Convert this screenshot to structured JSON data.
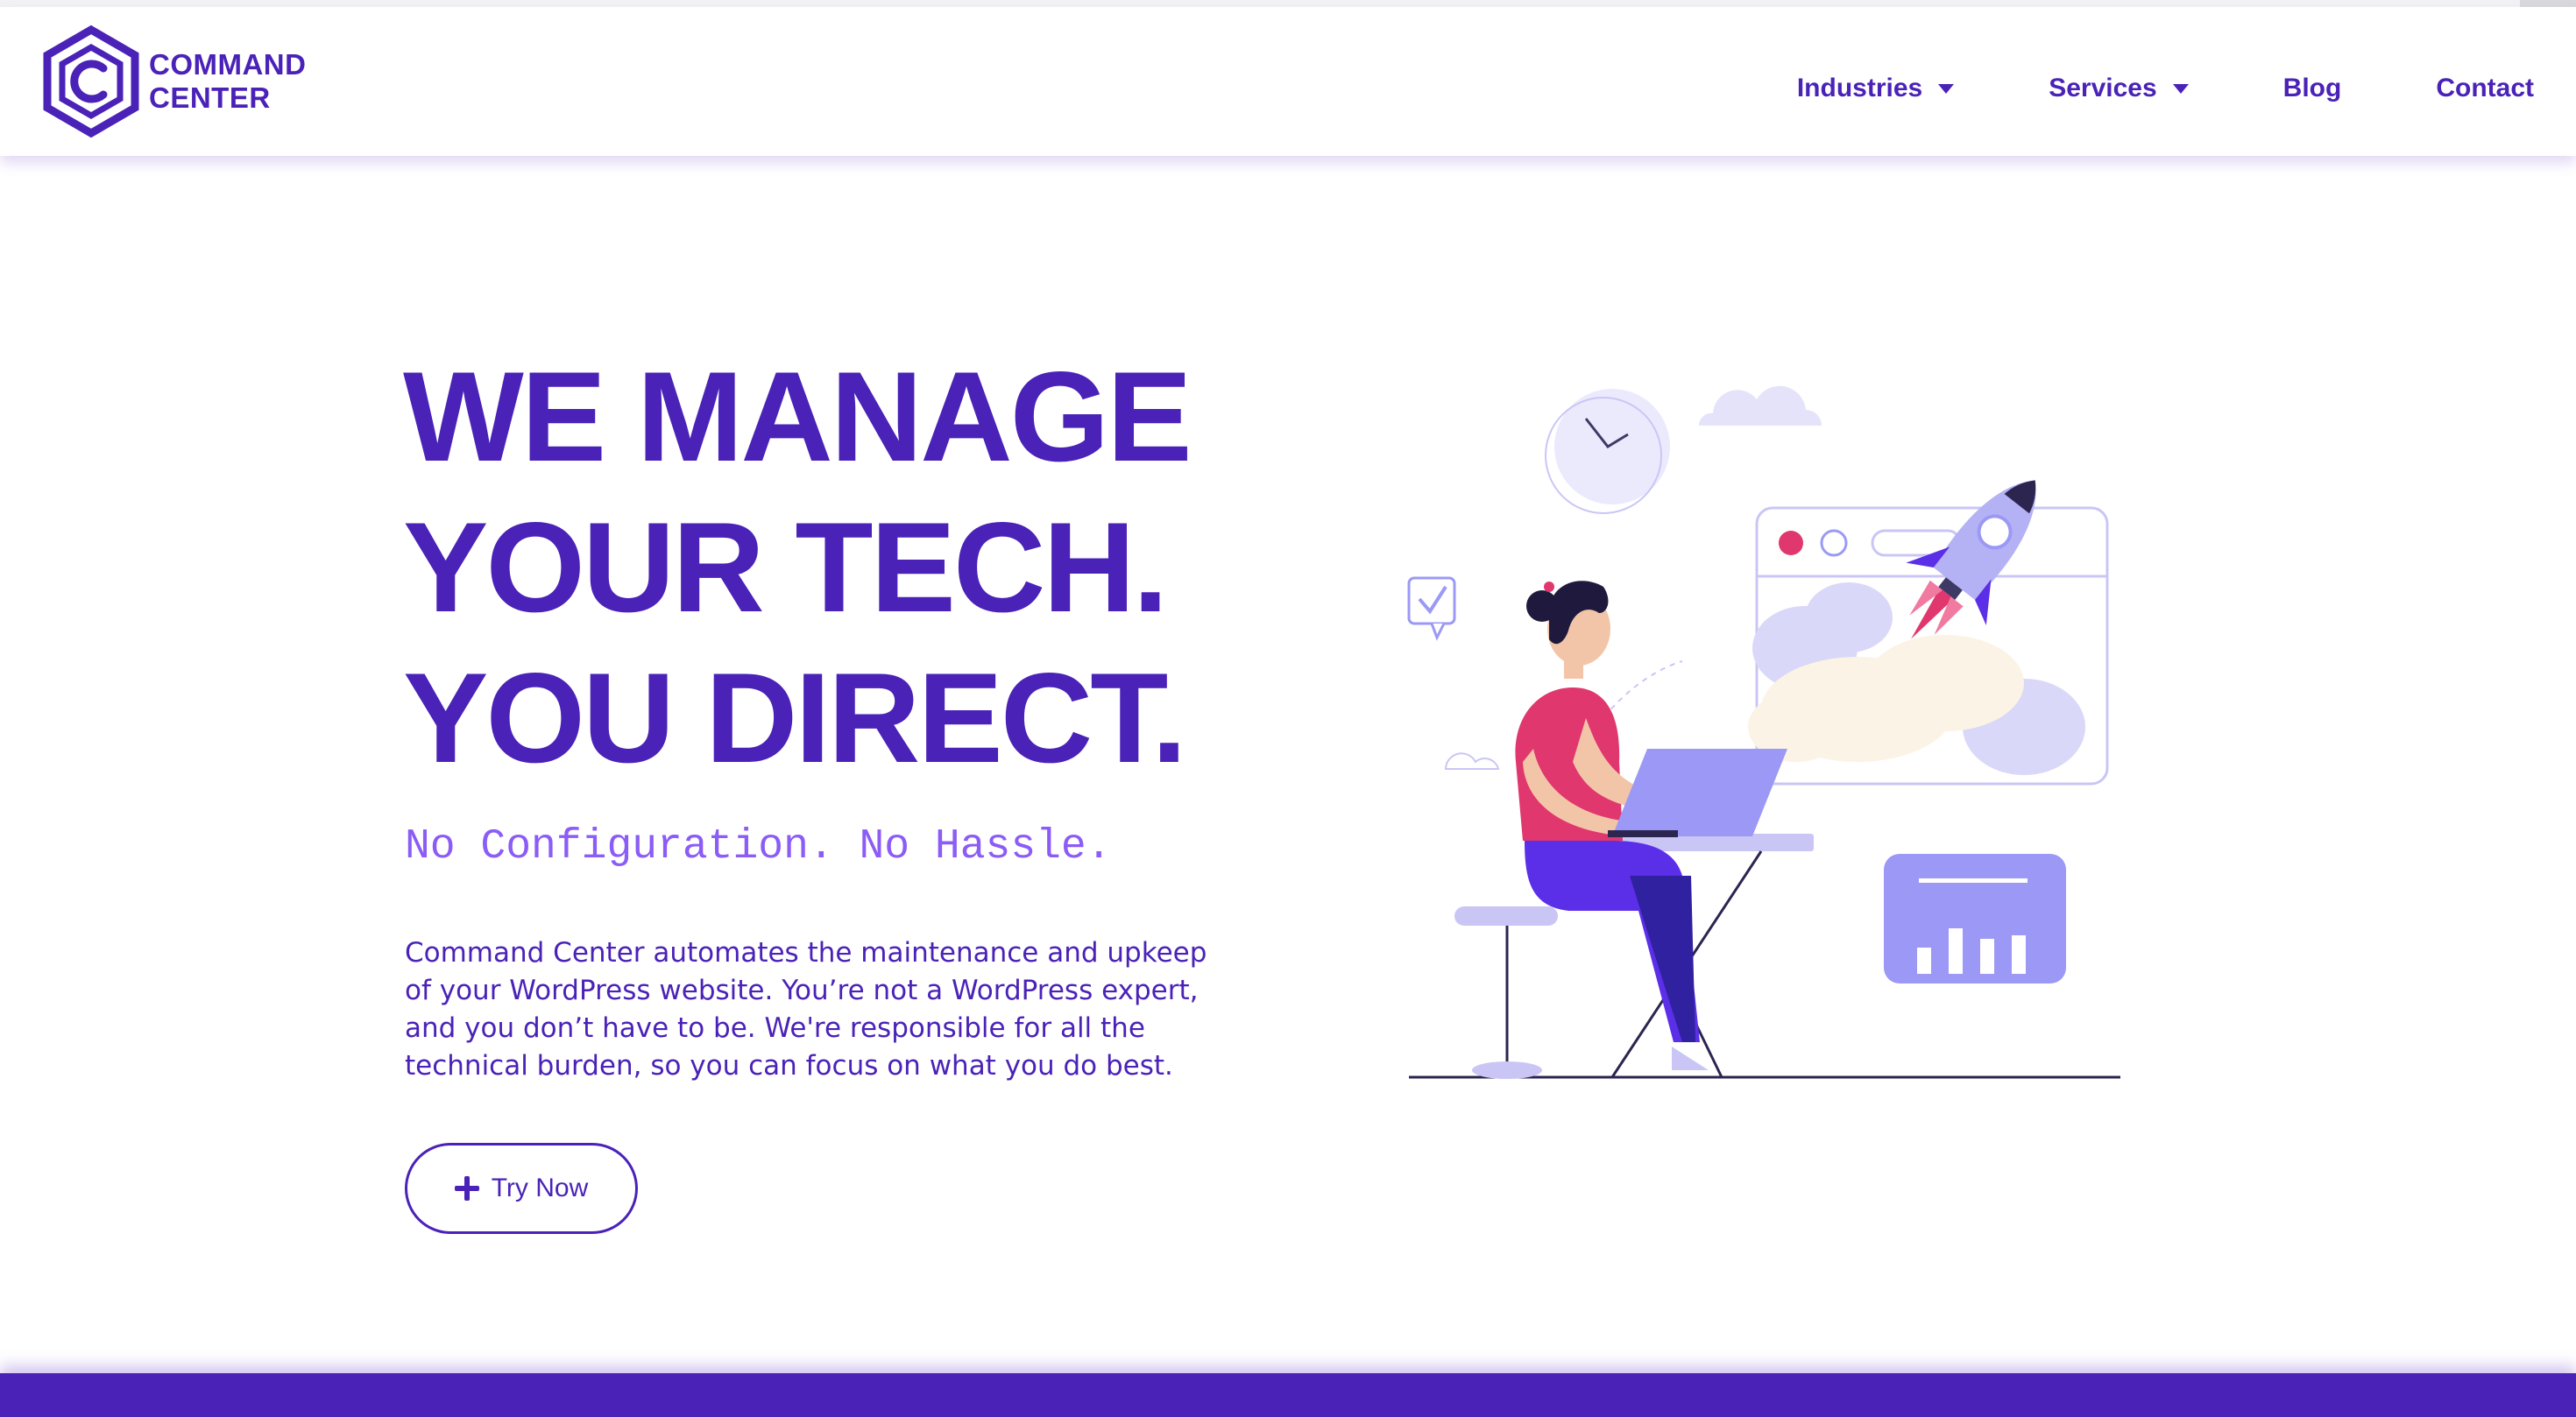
{
  "header": {
    "logo": {
      "line1": "COMMAND",
      "line2": "CENTER"
    },
    "nav": [
      {
        "label": "Industries",
        "has_dropdown": true
      },
      {
        "label": "Services",
        "has_dropdown": true
      },
      {
        "label": "Blog",
        "has_dropdown": false
      },
      {
        "label": "Contact",
        "has_dropdown": false
      }
    ]
  },
  "hero": {
    "title_lines": [
      "WE MANAGE",
      "YOUR TECH.",
      "YOU DIRECT."
    ],
    "subheading": "No Configuration. No Hassle.",
    "description": "Command Center automates the maintenance and upkeep of your WordPress website. You’re not a WordPress expert, and you don’t have to be. We're responsible for all the technical burden, so you can focus on what you do best.",
    "cta_label": "Try Now"
  },
  "icons": {
    "logo": "hexagon-c-logo",
    "dropdown": "caret-down-icon",
    "cta": "plus-icon"
  },
  "colors": {
    "brand": "#4a22b8",
    "accent_light": "#8b5cf6",
    "illustration_lavender": "#9b99f5",
    "illustration_pink": "#e0376e",
    "background": "#ffffff"
  }
}
